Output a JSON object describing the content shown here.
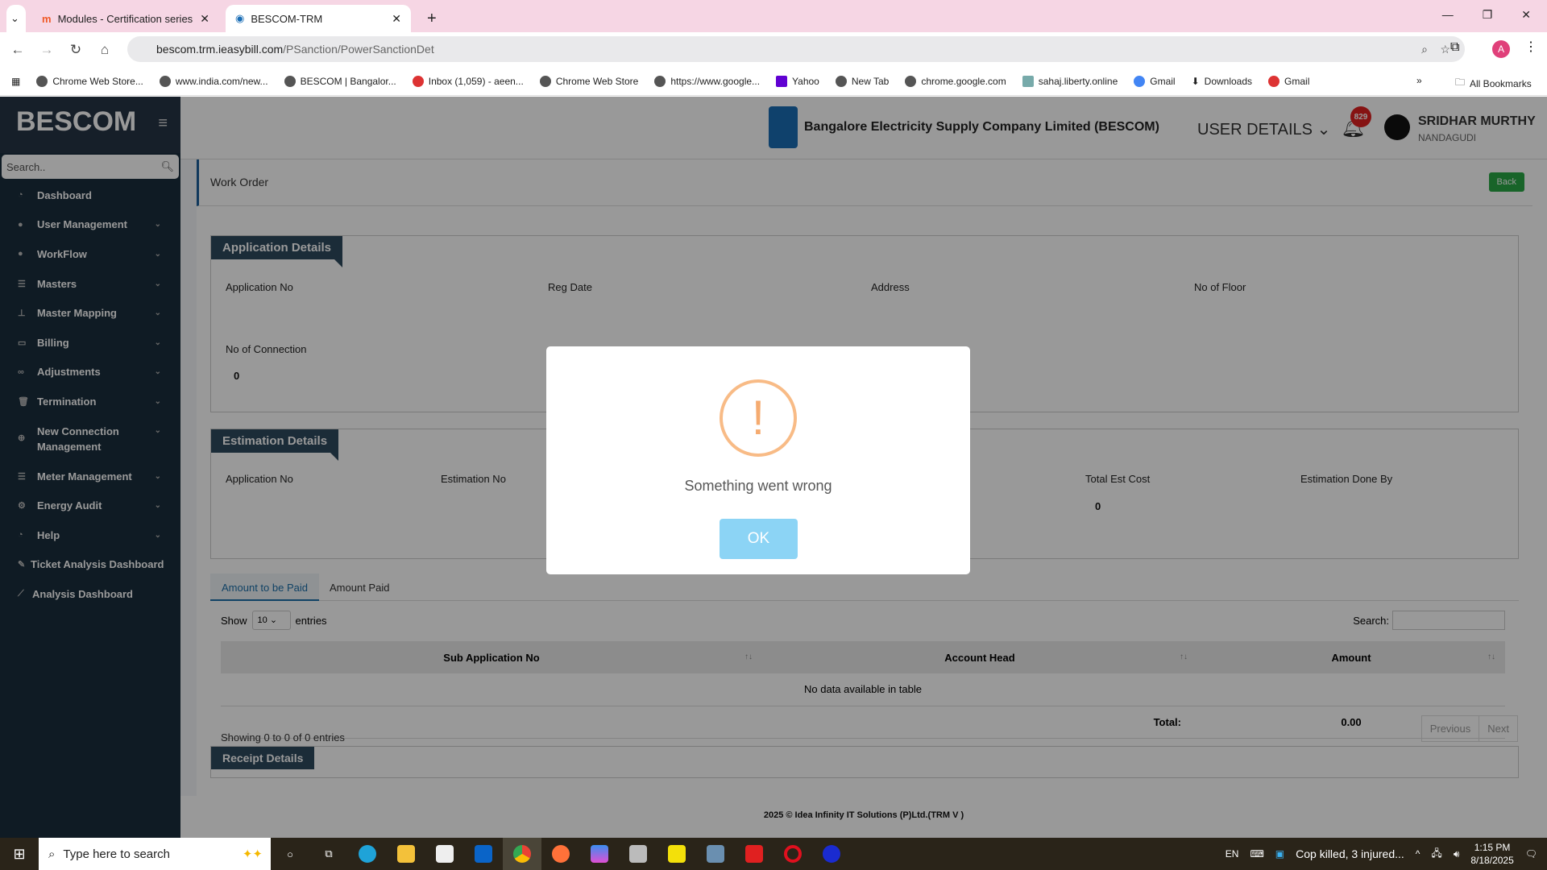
{
  "browser": {
    "tabs": [
      {
        "label": "Modules - Certification series"
      },
      {
        "label": "BESCOM-TRM"
      }
    ],
    "url_host": "bescom.trm.ieasybill.com",
    "url_path": "/PSanction/PowerSanctionDet",
    "bookmarks": [
      "Chrome Web Store...",
      "www.india.com/new...",
      "BESCOM | Bangalor...",
      "Inbox (1,059) - aeen...",
      "Chrome Web Store",
      "https://www.google...",
      "Yahoo",
      "New Tab",
      "chrome.google.com",
      "sahaj.liberty.online",
      "Gmail",
      "Downloads",
      "Gmail"
    ],
    "all_bookmarks": "All Bookmarks",
    "profile": "A"
  },
  "sidebar": {
    "brand": "BESCOM",
    "search_placeholder": "Search..",
    "items": [
      {
        "label": "Dashboard"
      },
      {
        "label": "User Management"
      },
      {
        "label": "WorkFlow"
      },
      {
        "label": "Masters"
      },
      {
        "label": "Master Mapping"
      },
      {
        "label": "Billing"
      },
      {
        "label": "Adjustments"
      },
      {
        "label": "Termination"
      },
      {
        "label": "New Connection Management"
      },
      {
        "label": "Meter Management"
      },
      {
        "label": "Energy Audit"
      },
      {
        "label": "Help"
      },
      {
        "label": "Ticket Analysis Dashboard"
      },
      {
        "label": "Analysis Dashboard"
      }
    ]
  },
  "header": {
    "company": "Bangalore Electricity Supply Company Limited (BESCOM)",
    "user_details": "USER DETAILS",
    "notifications": "829",
    "user_name": "SRIDHAR MURTHY",
    "user_location": "NANDAGUDI"
  },
  "page": {
    "title": "Work Order",
    "back": "Back",
    "application": {
      "title": "Application Details",
      "fields": [
        "Application No",
        "Reg Date",
        "Address",
        "No of Floor",
        "No of Connection"
      ],
      "no_of_connection": "0"
    },
    "estimation": {
      "title": "Estimation Details",
      "fields": [
        "Application No",
        "Estimation No",
        "Total Est Cost",
        "Estimation Done By"
      ],
      "total_est_cost": "0"
    },
    "tabs": [
      "Amount to be Paid",
      "Amount Paid"
    ],
    "table": {
      "show": "Show",
      "entries_value": "10",
      "entries": "entries",
      "search": "Search:",
      "columns": [
        "Sub Application No",
        "Account Head",
        "Amount"
      ],
      "empty": "No data available in table",
      "total_label": "Total:",
      "total_value": "0.00",
      "showing": "Showing 0 to 0 of 0 entries",
      "previous": "Previous",
      "next": "Next"
    },
    "receipt": "Receipt Details",
    "footer": "2025 © Idea Infinity IT Solutions (P)Ltd.(TRM V )"
  },
  "modal": {
    "message": "Something went wrong",
    "ok": "OK"
  },
  "taskbar": {
    "search": "Type here to search",
    "lang": "EN",
    "news": "Cop killed, 3 injured...",
    "time": "1:15 PM",
    "date": "8/18/2025"
  }
}
